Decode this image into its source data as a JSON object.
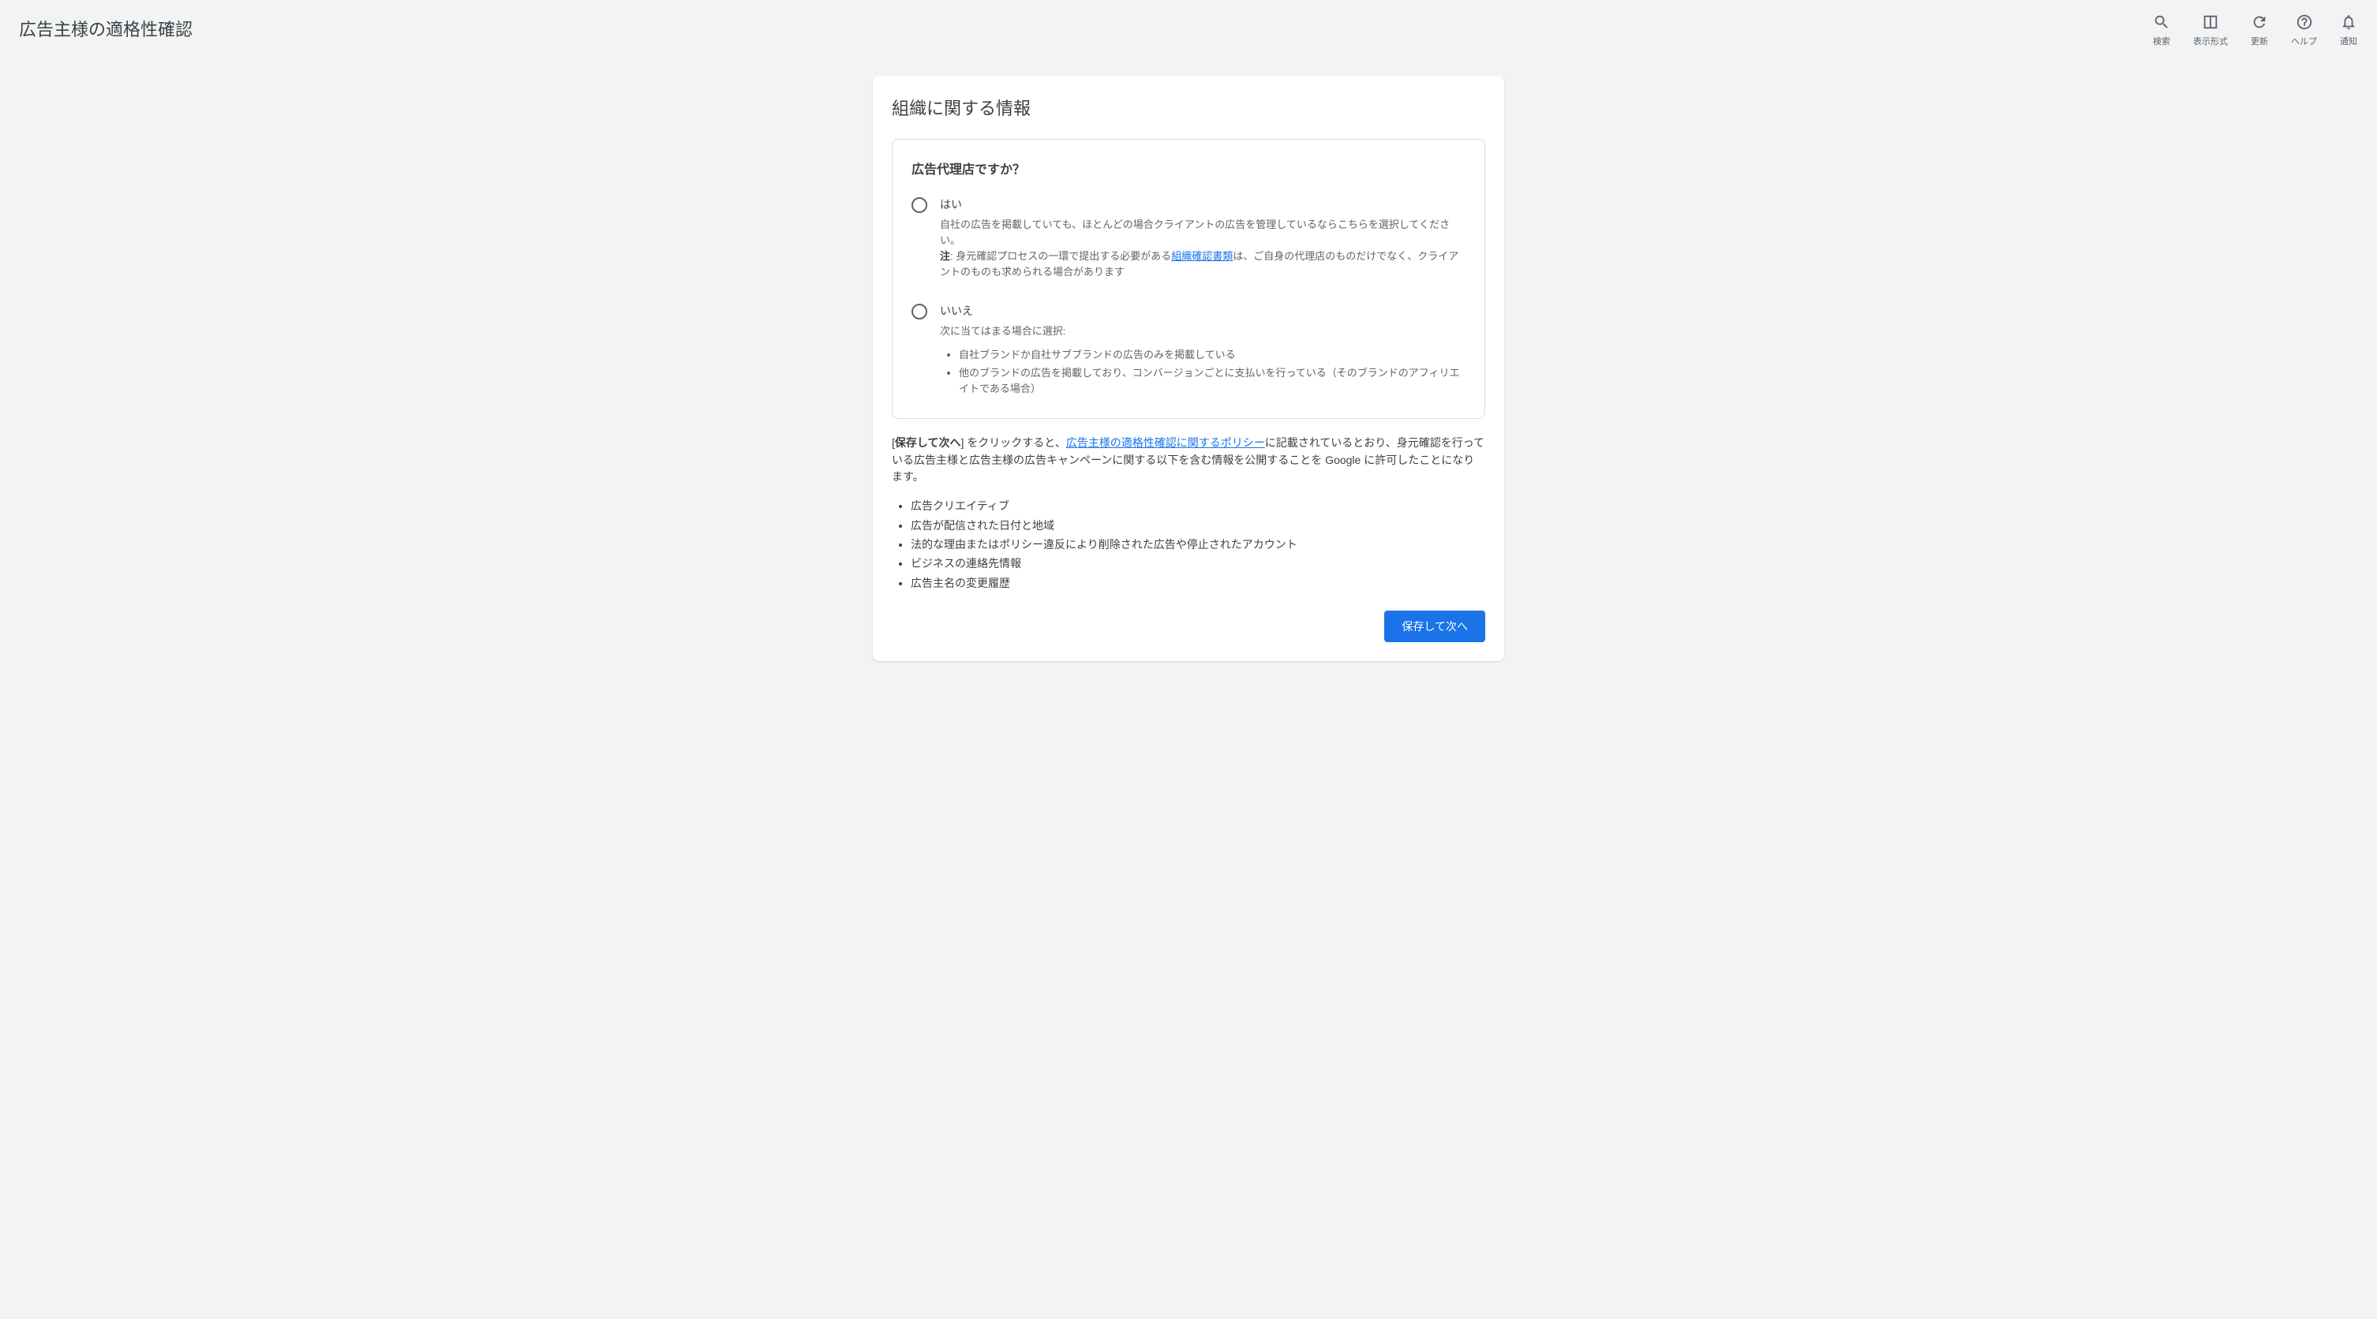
{
  "header": {
    "title": "広告主様の適格性確認",
    "actions": {
      "search": "検索",
      "appearance": "表示形式",
      "refresh": "更新",
      "help": "ヘルプ",
      "notifications": "通知"
    }
  },
  "card": {
    "title": "組織に関する情報",
    "question": {
      "title": "広告代理店ですか？",
      "options": {
        "yes": {
          "label": "はい",
          "desc_part1": "自社の広告を掲載していても、ほとんどの場合クライアントの広告を管理しているならこちらを選択してください。",
          "note_label": "注",
          "note_part1": ": 身元確認プロセスの一環で提出する必要がある",
          "note_link": "組織確認書類",
          "note_part2": "は、ご自身の代理店のものだけでなく、クライアントのものも求められる場合があります"
        },
        "no": {
          "label": "いいえ",
          "desc": "次に当てはまる場合に選択:",
          "bullets": [
            "自社ブランドか自社サブブランドの広告のみを掲載している",
            "他のブランドの広告を掲載しており、コンバージョンごとに支払いを行っている（そのブランドのアフィリエイトである場合）"
          ]
        }
      }
    },
    "policy": {
      "part1_bold_open": "[",
      "part1_bold": "保存して次へ",
      "part1_after_bold": "] をクリックすると、",
      "link": "広告主様の適格性確認に関するポリシー",
      "part2": "に記載されているとおり、身元確認を行っている広告主様と広告主様の広告キャンペーンに関する以下を含む情報を公開することを Google に許可したことになります。",
      "bullets": [
        "広告クリエイティブ",
        "広告が配信された日付と地域",
        "法的な理由またはポリシー違反により削除された広告や停止されたアカウント",
        "ビジネスの連絡先情報",
        "広告主名の変更履歴"
      ]
    },
    "button": "保存して次へ"
  }
}
